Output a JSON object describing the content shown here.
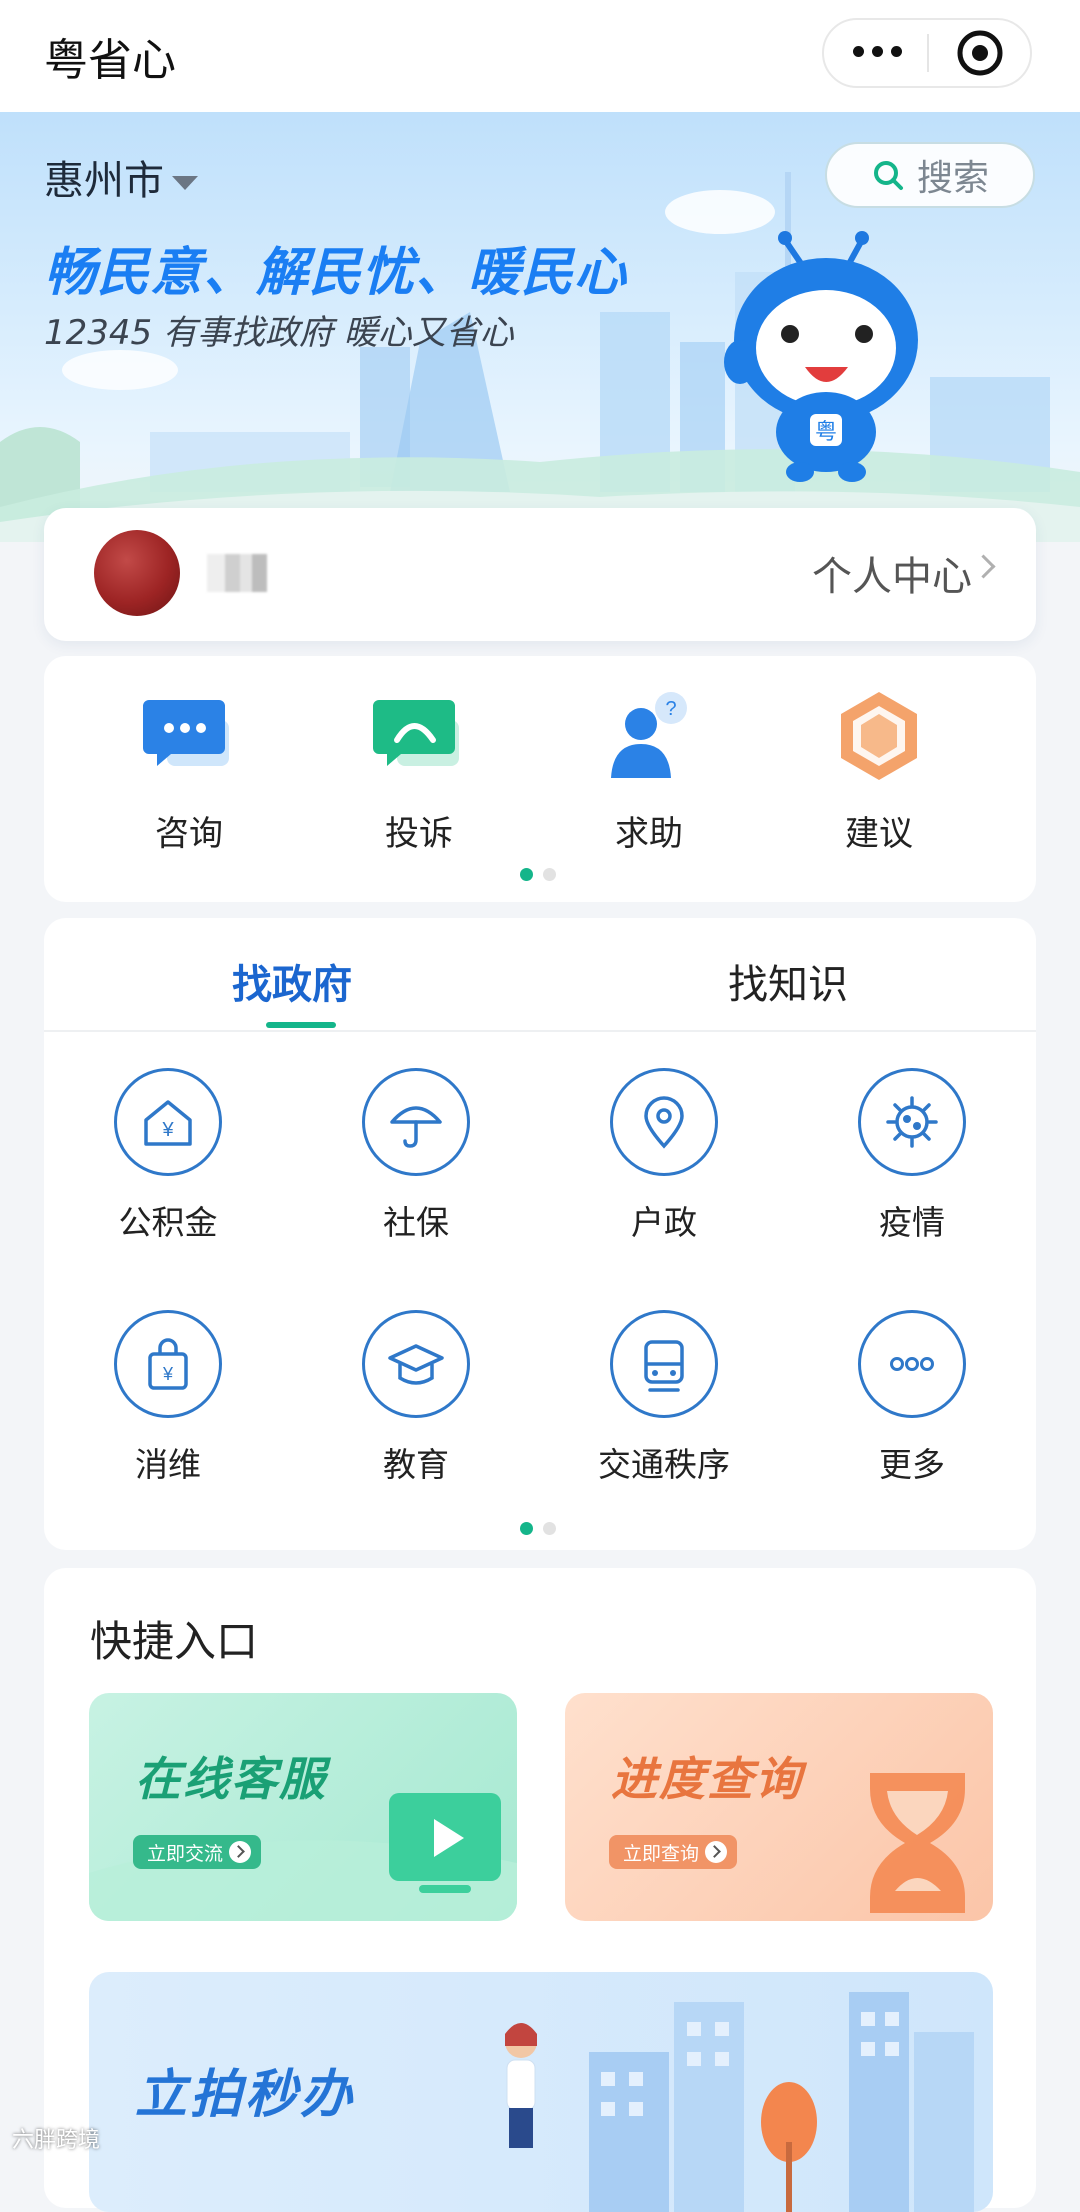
{
  "title_bar": {
    "app_title": "粤省心"
  },
  "hero": {
    "city": "惠州市",
    "search_label": "搜索",
    "slogan": "畅民意、解民忧、暖民心",
    "subslogan": "12345 有事找政府 暖心又省心",
    "mascot_badge": "粤"
  },
  "user_card": {
    "center_link": "个人中心"
  },
  "actions": [
    {
      "label": "咨询",
      "icon": "chat-bubble-icon"
    },
    {
      "label": "投诉",
      "icon": "complaint-icon"
    },
    {
      "label": "求助",
      "icon": "help-person-icon"
    },
    {
      "label": "建议",
      "icon": "suggestion-medal-icon"
    }
  ],
  "services": {
    "tabs": [
      {
        "label": "找政府",
        "active": true
      },
      {
        "label": "找知识",
        "active": false
      }
    ],
    "items": [
      {
        "label": "公积金",
        "icon": "housing-fund-icon"
      },
      {
        "label": "社保",
        "icon": "umbrella-icon"
      },
      {
        "label": "户政",
        "icon": "location-pin-icon"
      },
      {
        "label": "疫情",
        "icon": "virus-icon"
      },
      {
        "label": "消维",
        "icon": "shopping-bag-icon"
      },
      {
        "label": "教育",
        "icon": "graduation-cap-icon"
      },
      {
        "label": "交通秩序",
        "icon": "train-icon"
      },
      {
        "label": "更多",
        "icon": "more-dots-icon"
      }
    ]
  },
  "quick": {
    "title": "快捷入口",
    "tiles": [
      {
        "title": "在线客服",
        "button": "立即交流"
      },
      {
        "title": "进度查询",
        "button": "立即查询"
      },
      {
        "title": "立拍秒办"
      }
    ]
  },
  "watermark": "六胖跨境",
  "colors": {
    "primary_blue": "#1b66cf",
    "accent_green": "#14b58a",
    "slogan_blue": "#1a7ef3"
  }
}
